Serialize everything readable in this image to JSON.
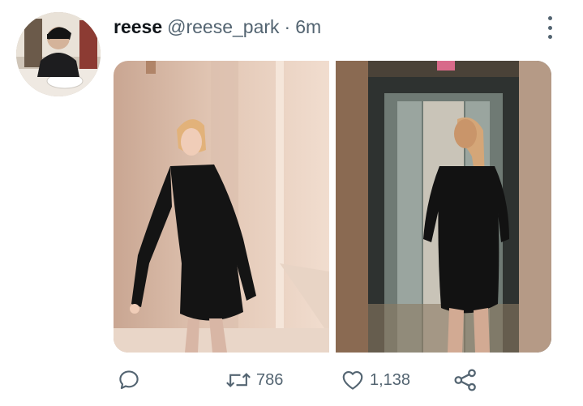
{
  "tweet": {
    "display_name": "reese",
    "handle": "@reese_park",
    "separator": "·",
    "time": "6m"
  },
  "media": {
    "photos": [
      {
        "description": "woman in black ruched dress posing against a beige wall"
      },
      {
        "description": "woman in black dress walking into an elevator"
      }
    ]
  },
  "actions": {
    "reply_count": "",
    "retweet_count": "786",
    "like_count": "1,138"
  },
  "colors": {
    "secondary_text": "#536471",
    "primary_text": "#0f1419"
  }
}
